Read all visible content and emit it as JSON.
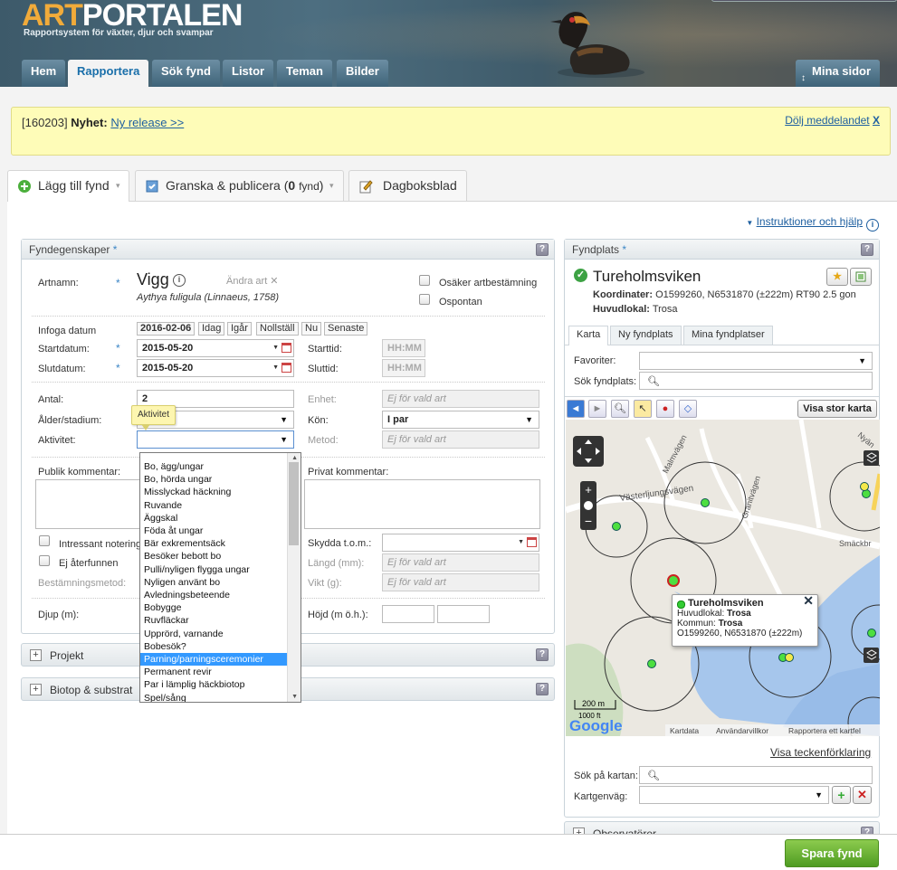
{
  "header": {
    "logo_art": "ART",
    "logo_portalen": "PORTALEN",
    "tagline": "Rapportsystem för växter, djur och svampar",
    "nav": [
      {
        "label": "Hem"
      },
      {
        "label": "Rapportera",
        "active": true
      },
      {
        "label": "Sök fynd"
      },
      {
        "label": "Listor"
      },
      {
        "label": "Teman"
      },
      {
        "label": "Bilder"
      }
    ],
    "mine": "Mina sidor"
  },
  "notice": {
    "id": "[160203]",
    "title": "Nyhet:",
    "link": "Ny release >>",
    "hide": "Dölj meddelandet",
    "hide_x": "X"
  },
  "tabs": {
    "add": "Lägg till fynd",
    "review": "Granska & publicera",
    "review_count": "0",
    "review_unit": "fynd",
    "diary": "Dagboksblad"
  },
  "help_link": "Instruktioner och hjälp",
  "fyndegenskaper": {
    "title": "Fyndegenskaper",
    "artnamn_label": "Artnamn:",
    "species": "Vigg",
    "species_latin": "Aythya fuligula (Linnaeus, 1758)",
    "change_species": "Ändra art",
    "uncertain": "Osäker artbestämning",
    "spontaneous": "Ospontan",
    "infoga_label": "Infoga datum",
    "date_buttons": [
      "2016-02-06",
      "Idag",
      "Igår",
      "Nollställ",
      "Nu",
      "Senaste"
    ],
    "start_label": "Startdatum:",
    "start_value": "2015-05-20",
    "end_label": "Slutdatum:",
    "end_value": "2015-05-20",
    "starttime_label": "Starttid:",
    "endtime_label": "Sluttid:",
    "time_placeholder": "HH:MM",
    "antal_label": "Antal:",
    "antal_value": "2",
    "enhet_label": "Enhet:",
    "na_text": "Ej för vald art",
    "alder_label": "Ålder/stadium:",
    "kon_label": "Kön:",
    "kon_value": "I par",
    "aktivitet_label": "Aktivitet:",
    "metod_label": "Metod:",
    "tooltip": "Aktivitet",
    "public_comment": "Publik kommentar:",
    "private_comment": "Privat kommentar:",
    "interesting": "Intressant notering",
    "not_refound": "Ej återfunnen",
    "method_det": "Bestämningsmetod:",
    "protect": "Skydda t.o.m.:",
    "length": "Längd (mm):",
    "weight": "Vikt (g):",
    "depth": "Djup (m):",
    "height": "Höjd (m ö.h.):"
  },
  "activity_options": [
    "Bo, ägg/ungar",
    "Bo, hörda ungar",
    "Misslyckad häckning",
    "Ruvande",
    "Äggskal",
    "Föda åt ungar",
    "Bär exkrementsäck",
    "Besöker bebott bo",
    "Pulli/nyligen flygga ungar",
    "Nyligen använt bo",
    "Avledningsbeteende",
    "Bobygge",
    "Ruvfläckar",
    "Upprörd, varnande",
    "Bobesök?",
    "Parning/parningsceremonier",
    "Permanent revir",
    "Par i lämplig häckbiotop",
    "Spel/sång"
  ],
  "activity_highlighted": "Parning/parningsceremonier",
  "projekt": "Projekt",
  "biotop": "Biotop & substrat",
  "fyndplats": {
    "title": "Fyndplats",
    "name": "Tureholmsviken",
    "coord_label": "Koordinater:",
    "coord_value": "O1599260, N6531870 (±222m) RT90 2.5 gon",
    "huvud_label": "Huvudlokal:",
    "huvud_value": "Trosa",
    "subtabs": [
      "Karta",
      "Ny fyndplats",
      "Mina fyndplatser"
    ],
    "favoriter": "Favoriter:",
    "sok_fyndplats": "Sök fyndplats:",
    "big_map": "Visa stor karta",
    "legend_link": "Visa teckenförklaring",
    "sok_kartan": "Sök på kartan:",
    "kartgenvag": "Kartgenväg:"
  },
  "map": {
    "streets": [
      "Västerljungsvägen",
      "Malmvägen",
      "Granitvägen",
      "Smäckbr",
      "Nyän"
    ],
    "popup_title": "Tureholmsviken",
    "popup_l1_label": "Huvudlokal:",
    "popup_l1_value": "Trosa",
    "popup_l2_label": "Kommun:",
    "popup_l2_value": "Trosa",
    "popup_l3": "O1599260, N6531870 (±222m)",
    "scale_m": "200 m",
    "scale_ft": "1000 ft",
    "google": "Google",
    "attrib": [
      "Kartdata",
      "Användarvillkor",
      "Rapportera ett kartfel"
    ]
  },
  "observers": "Observatörer",
  "save": "Spara fynd"
}
